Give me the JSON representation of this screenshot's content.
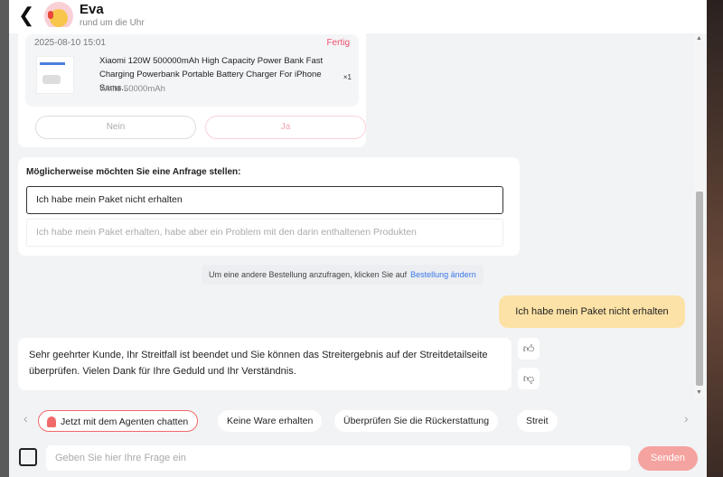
{
  "header": {
    "title": "Eva",
    "subtitle": "rund um die Uhr"
  },
  "order": {
    "date": "2025-08-10 15:01",
    "status": "Fertig",
    "name": "Xiaomi 120W 500000mAh High Capacity Power Bank Fast Charging Powerbank Portable Battery Charger For iPhone Sams...",
    "variant": "White 50000mAh",
    "qty": "×1",
    "no": "Nein",
    "yes": "Ja"
  },
  "inquiry": {
    "title": "Möglicherweise möchten Sie eine Anfrage stellen:",
    "options": [
      "Ich habe mein Paket nicht erhalten",
      "Ich habe mein Paket erhalten, habe aber ein Problem mit den darin enthaltenen Produkten"
    ]
  },
  "hint": {
    "text": "Um eine andere Bestellung anzufragen, klicken Sie auf",
    "link": "Bestellung ändern"
  },
  "messages": {
    "user": "Ich habe mein Paket nicht erhalten",
    "agent": "Sehr geehrter Kunde, Ihr Streitfall ist beendet und Sie können das Streitergebnis auf der Streitdetailseite überprüfen. Vielen Dank für Ihre Geduld und Ihr Verständnis."
  },
  "quick": [
    "Jetzt mit dem Agenten chatten",
    "Keine Ware erhalten",
    "Überprüfen Sie die Rückerstattung",
    "Streit"
  ],
  "composer": {
    "placeholder": "Geben Sie hier Ihre Frage ein",
    "send": "Senden"
  }
}
